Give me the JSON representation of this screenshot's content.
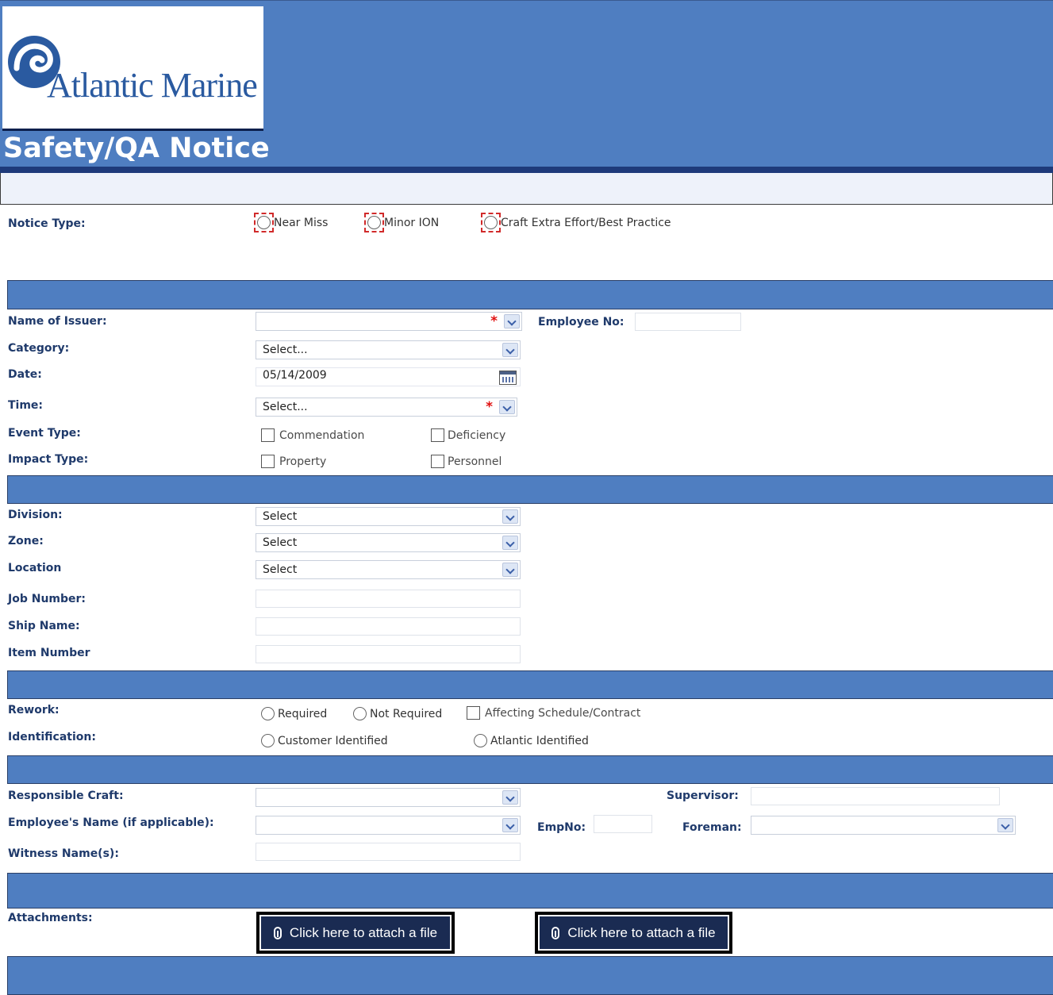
{
  "header": {
    "logo_text": "Atlantic Marine",
    "title": "Safety/QA Notice"
  },
  "notice_type": {
    "label": "Notice Type:",
    "options": [
      "Near Miss",
      "Minor ION",
      "Craft Extra Effort/Best Practice"
    ]
  },
  "issuer": {
    "name_label": "Name of Issuer:",
    "name_value": "",
    "employee_no_label": "Employee No:",
    "employee_no_value": "",
    "category_label": "Category:",
    "category_value": "Select...",
    "date_label": "Date:",
    "date_value": "05/14/2009",
    "time_label": "Time:",
    "time_value": "Select...",
    "required_marker": "*",
    "event_type_label": "Event Type:",
    "event_types": [
      "Commendation",
      "Deficiency"
    ],
    "impact_type_label": "Impact Type:",
    "impact_types": [
      "Property",
      "Personnel"
    ]
  },
  "location": {
    "division_label": "Division:",
    "division_value": "Select",
    "zone_label": "Zone:",
    "zone_value": "Select",
    "location_label": "Location",
    "location_value": "Select",
    "job_number_label": "Job Number:",
    "ship_name_label": "Ship Name:",
    "item_number_label": "Item Number"
  },
  "rework": {
    "rework_label": "Rework:",
    "rework_options": [
      "Required",
      "Not Required"
    ],
    "affecting_label": "Affecting Schedule/Contract",
    "identification_label": "Identification:",
    "identification_options": [
      "Customer Identified",
      "Atlantic Identified"
    ]
  },
  "responsible": {
    "craft_label": "Responsible Craft:",
    "supervisor_label": "Supervisor:",
    "employee_name_label": "Employee's Name (if applicable):",
    "empno_label": "EmpNo:",
    "foreman_label": "Foreman:",
    "witness_label": "Witness Name(s):"
  },
  "attachments": {
    "label": "Attachments:",
    "button_label": "Click here to attach a file"
  },
  "colors": {
    "header_blue": "#4f7ec1",
    "dark_navy": "#1e3a7a",
    "label_navy": "#1f3a6b",
    "required_red": "#e01010"
  }
}
